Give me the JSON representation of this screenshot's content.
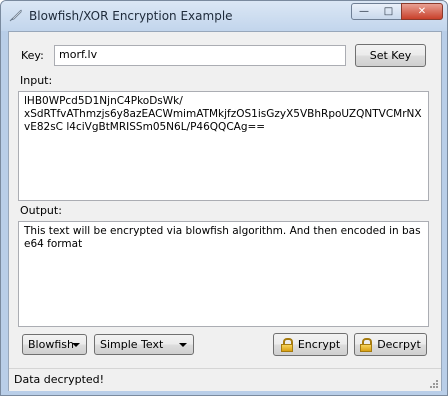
{
  "window": {
    "title": "Blowfish/XOR Encryption Example",
    "controls": {
      "minimize": "—",
      "maximize": "□",
      "close": "✕"
    }
  },
  "key": {
    "label": "Key:",
    "value": "morf.lv",
    "set_button": "Set Key"
  },
  "input": {
    "label": "Input:",
    "text": "lHB0WPcd5D1NjnC4PkoDsWk/\nxSdRTfvAThmzjs6y8azEACWmimATMkjfzOS1isGzyX5VBhRpoUZQNTVCMrNXvE82sC l4ciVgBtMRISSm05N6L/P46QQCAg=="
  },
  "output": {
    "label": "Output:",
    "text": "This text will be encrypted via blowfish algorithm. And then encoded in base64 format"
  },
  "controls": {
    "algorithm_selected": "Blowfish",
    "format_selected": "Simple Text",
    "encrypt_button": "Encrypt",
    "decrypt_button": "Decrpyt"
  },
  "status": {
    "text": "Data decrypted!"
  }
}
